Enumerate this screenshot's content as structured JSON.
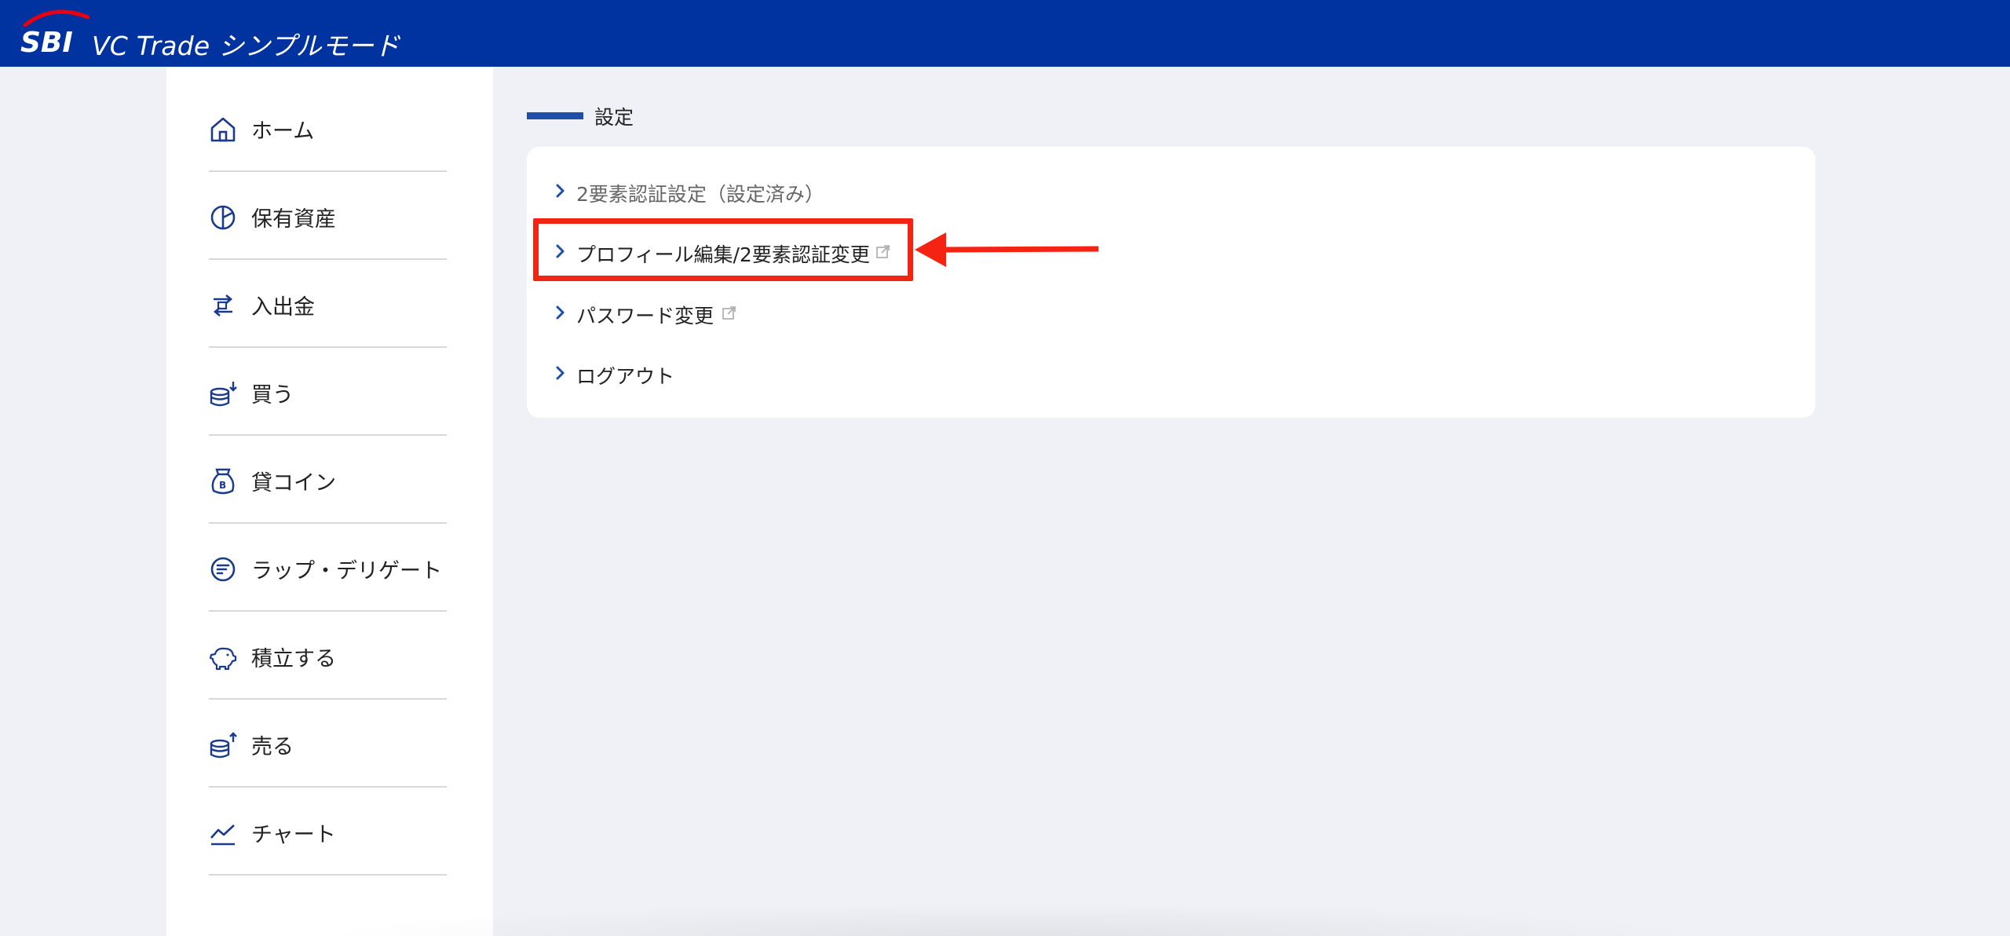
{
  "header": {
    "logo_text": "SBI",
    "brand": "VC Trade シンプルモード",
    "bg_color": "#0033a0"
  },
  "sidebar": {
    "items": [
      {
        "label": "ホーム",
        "icon": "home-icon"
      },
      {
        "label": "保有資産",
        "icon": "pie-chart-icon"
      },
      {
        "label": "入出金",
        "icon": "transfer-icon"
      },
      {
        "label": "買う",
        "icon": "buy-coins-icon"
      },
      {
        "label": "貸コイン",
        "icon": "money-bag-icon"
      },
      {
        "label": "ラップ・デリゲート",
        "icon": "wrap-icon"
      },
      {
        "label": "積立する",
        "icon": "piggy-bank-icon"
      },
      {
        "label": "売る",
        "icon": "sell-coins-icon"
      },
      {
        "label": "チャート",
        "icon": "chart-line-icon"
      }
    ]
  },
  "settings": {
    "title": "設定",
    "items": [
      {
        "label": "2要素認証設定（設定済み）",
        "muted": true,
        "external": false
      },
      {
        "label": "プロフィール編集/2要素認証変更",
        "muted": false,
        "external": true
      },
      {
        "label": "パスワード変更",
        "muted": false,
        "external": true
      },
      {
        "label": "ログアウト",
        "muted": false,
        "external": false
      }
    ]
  },
  "annotation": {
    "highlight_color": "#f52312"
  },
  "colors": {
    "accent": "#1f4fa8",
    "page_bg": "#eff1f6"
  }
}
